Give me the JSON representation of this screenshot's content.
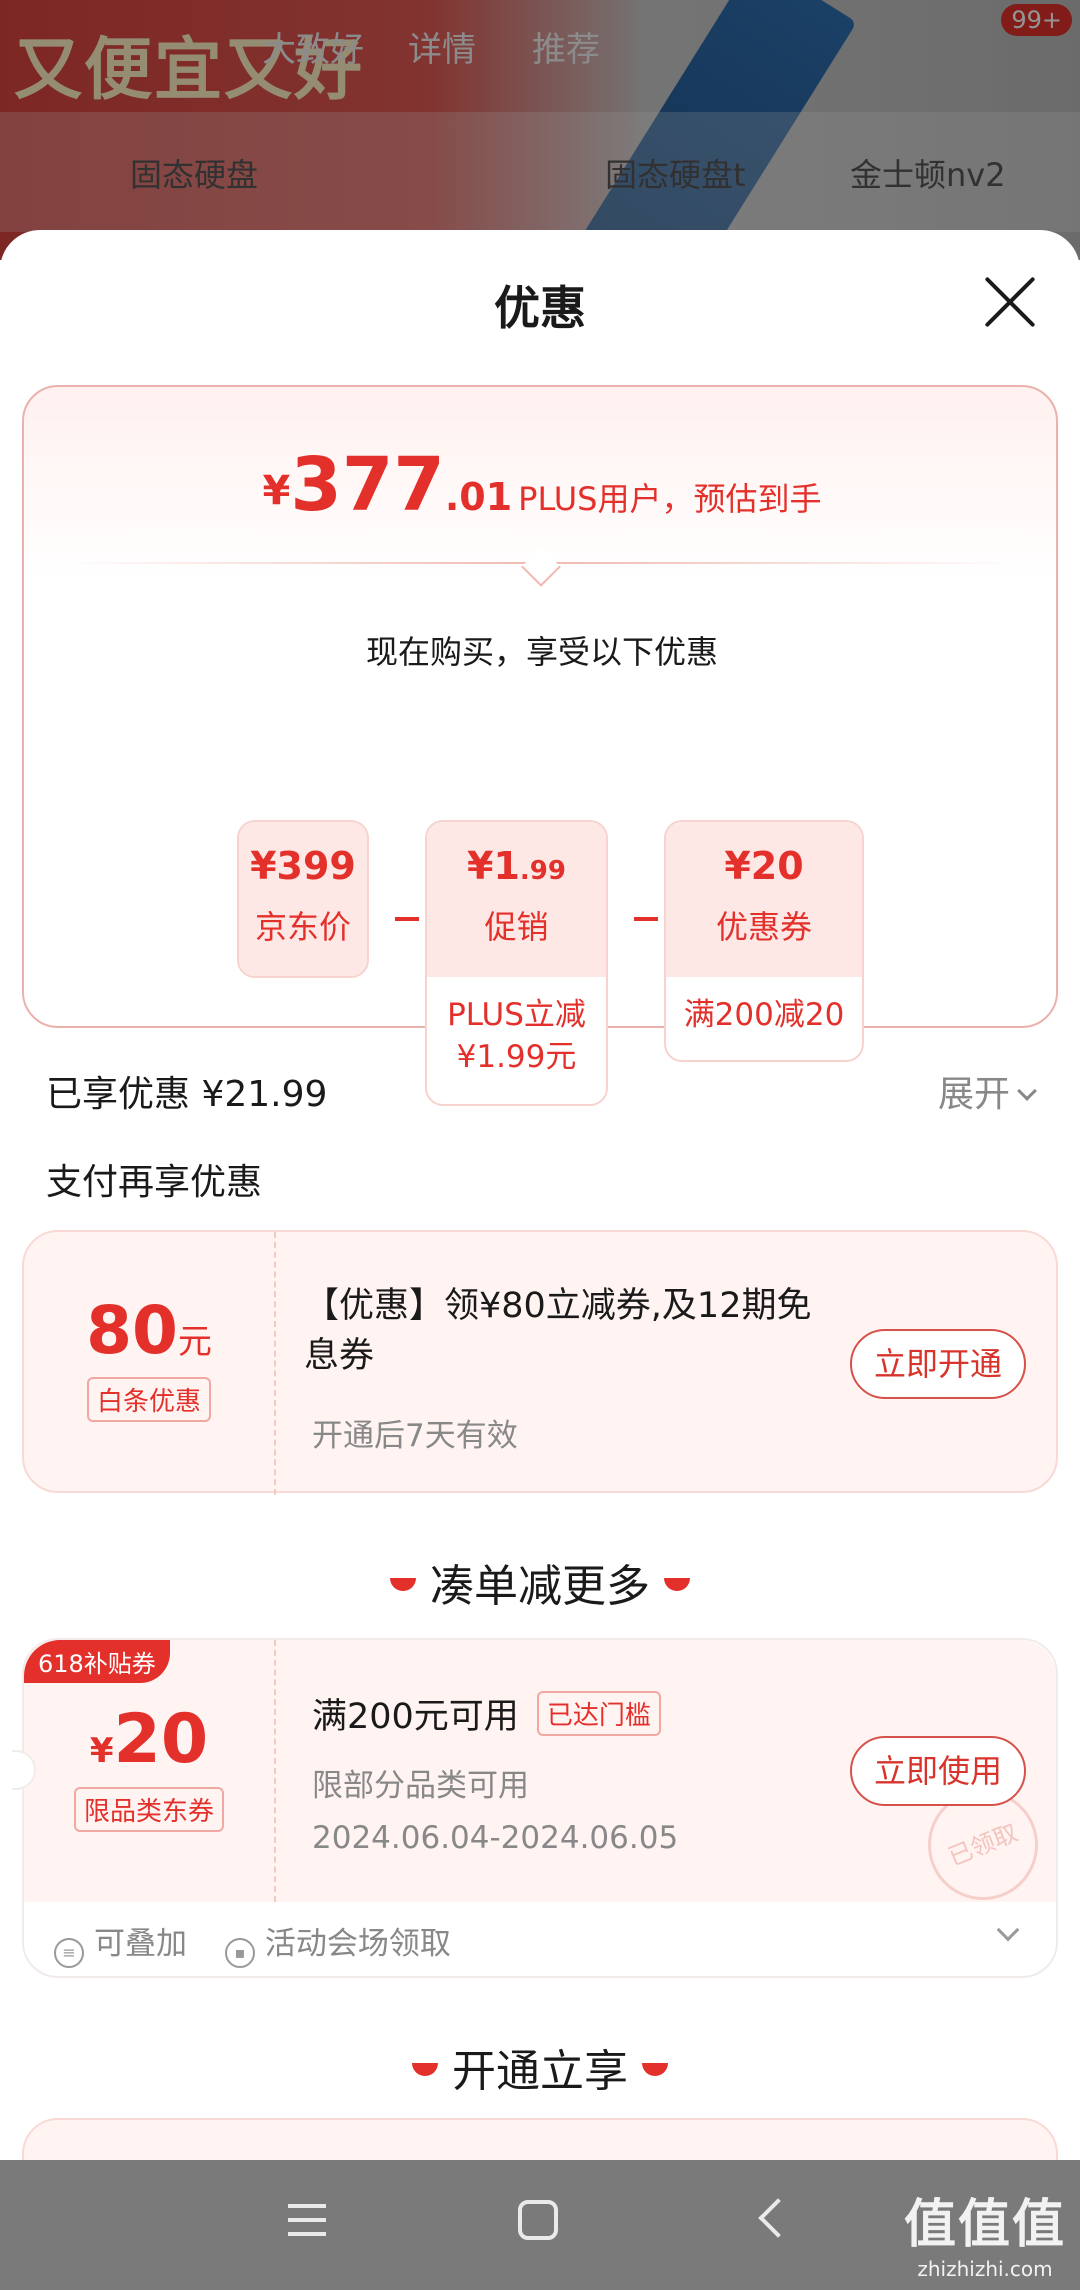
{
  "background": {
    "banner_text": "又便宜又好",
    "tabs": [
      "大致好",
      "详情",
      "推荐"
    ],
    "badge": "99+",
    "subtabs": [
      "固态硬盘",
      "固态硬盘t",
      "金士顿nv2"
    ]
  },
  "sheet": {
    "title": "优惠"
  },
  "price_card": {
    "yen": "¥",
    "price_int": "377",
    "price_dec": ".01",
    "price_note": "PLUS用户，预估到手",
    "buy_now_text": "现在购买，享受以下优惠",
    "chips": [
      {
        "value": "¥399",
        "label": "京东价"
      },
      {
        "value": "¥1",
        "value_dec": ".99",
        "label": "促销",
        "detail": "PLUS立减\n¥1.99元"
      },
      {
        "value": "¥20",
        "label": "优惠券",
        "detail": "满200减20"
      }
    ]
  },
  "enjoyed": {
    "text": "已享优惠 ¥21.99",
    "expand_label": "展开"
  },
  "pay_more": {
    "title": "支付再享优惠",
    "card": {
      "amount": "80",
      "unit": "元",
      "tag": "白条优惠",
      "desc": "【优惠】领¥80立减券,及12期免息券",
      "sub": "开通后7天有效",
      "button": "立即开通"
    }
  },
  "combine": {
    "title": "凑单减更多",
    "coupon": {
      "corner_badge": "618补贴券",
      "yen": "¥",
      "amount": "20",
      "tag": "限品类东券",
      "title": "满200元可用",
      "reached": "已达门槛",
      "scope": "限部分品类可用",
      "date": "2024.06.04-2024.06.05",
      "button": "立即使用",
      "stamp": "已领取",
      "stackable": "可叠加",
      "source": "活动会场领取"
    }
  },
  "open_enjoy": {
    "title": "开通立享"
  },
  "watermark": {
    "big": "值值值",
    "small": "zhizhizhi.com"
  },
  "colors": {
    "accent": "#e4302b",
    "card_bg": "#fff4f2",
    "navbar": "#7a7a7a"
  }
}
